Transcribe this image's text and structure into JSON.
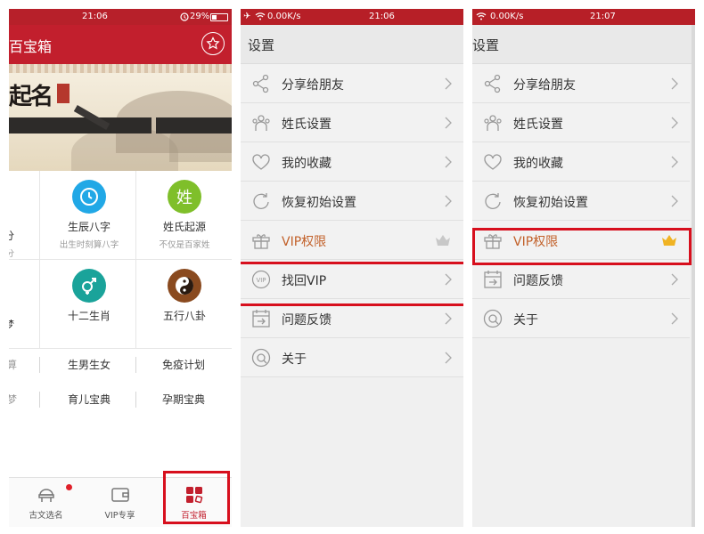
{
  "panel1": {
    "status": {
      "time": "21:06",
      "battery": "29%"
    },
    "title": "百宝箱",
    "grid": [
      {
        "name": "生辰八字",
        "sub": "出生时刻算八字"
      },
      {
        "name": "姓氏起源",
        "sub": "不仅是百家姓",
        "icon_text": "姓"
      },
      {
        "name": "十二生肖"
      },
      {
        "name": "五行八卦"
      }
    ],
    "partial_left": {
      "row1_name": "分",
      "row1_sub": "分",
      "row2_name": "梦"
    },
    "links_row1": [
      "生男生女",
      "免疫计划"
    ],
    "links_row2": [
      "育儿宝典",
      "孕期宝典"
    ],
    "partial_links": [
      "算",
      "梦"
    ],
    "tabs": [
      {
        "label": "古文选名",
        "icon": "cloud-dome-icon"
      },
      {
        "label": "VIP专享",
        "icon": "wallet-icon"
      },
      {
        "label": "百宝箱",
        "icon": "grid-squares-icon"
      }
    ],
    "colors": {
      "brand_red": "#c21f2d",
      "highlight": "#d70f1d"
    }
  },
  "panel2": {
    "status": {
      "speed": "0.00K/s",
      "time": "21:06"
    },
    "title": "设置",
    "items": [
      {
        "label": "分享给朋友",
        "icon": "share-icon"
      },
      {
        "label": "姓氏设置",
        "icon": "people-icon"
      },
      {
        "label": "我的收藏",
        "icon": "heart-icon"
      },
      {
        "label": "恢复初始设置",
        "icon": "refresh-icon"
      },
      {
        "label": "VIP权限",
        "icon": "gift-icon"
      },
      {
        "label": "找回VIP",
        "icon": "vip-badge-icon",
        "badge": "VIP"
      },
      {
        "label": "问题反馈",
        "icon": "calendar-icon"
      },
      {
        "label": "关于",
        "icon": "search-icon"
      }
    ]
  },
  "panel3": {
    "status": {
      "speed": "0.00K/s",
      "time": "21:07"
    },
    "title": "设置",
    "items": [
      {
        "label": "分享给朋友",
        "icon": "share-icon"
      },
      {
        "label": "姓氏设置",
        "icon": "people-icon"
      },
      {
        "label": "我的收藏",
        "icon": "heart-icon"
      },
      {
        "label": "恢复初始设置",
        "icon": "refresh-icon"
      },
      {
        "label": "VIP权限",
        "icon": "gift-icon"
      },
      {
        "label": "问题反馈",
        "icon": "calendar-icon"
      },
      {
        "label": "关于",
        "icon": "search-icon"
      }
    ],
    "vip_color": "#c2612a",
    "crown_color": "#f0b323"
  }
}
